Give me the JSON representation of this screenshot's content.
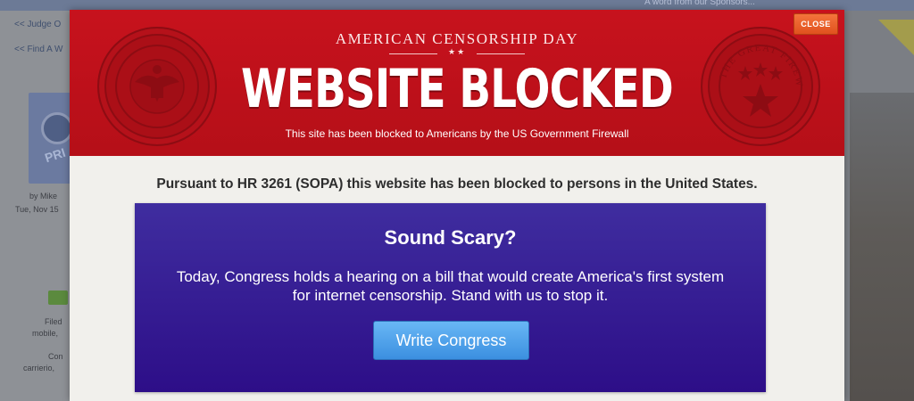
{
  "background_page": {
    "top_banner": "A word from our Sponsors...",
    "links": [
      "<< Judge O",
      "<< Find A W"
    ],
    "thumbnail_word": "PRI",
    "byline": "by Mike",
    "date": "Tue, Nov 15",
    "meta_lines": [
      "Filed",
      "mobile,",
      "Con",
      "carrierio,"
    ]
  },
  "modal": {
    "close_label": "CLOSE",
    "kicker": "AMERICAN CENSORSHIP DAY",
    "kicker_stars": "★★",
    "headline": "WEBSITE BLOCKED",
    "subline": "This site has been blocked to Americans by the US Government Firewall",
    "right_seal_text": "THE GREAT FIREWALL",
    "notice": "Pursuant to HR 3261 (SOPA) this website has been blocked to persons in the United States.",
    "cta": {
      "title": "Sound Scary?",
      "text_line1": "Today, Congress holds a hearing on a bill that would create America's first system",
      "text_line2": "for internet censorship. Stand with us to stop it.",
      "button_label": "Write Congress"
    }
  },
  "colors": {
    "header_red": "#c7121d",
    "cta_purple": "#2d0e88",
    "button_blue": "#3b8fe0",
    "close_orange": "#e0521e"
  },
  "icons": [
    "presidential-seal-icon",
    "great-firewall-seal-icon",
    "star-icon"
  ]
}
